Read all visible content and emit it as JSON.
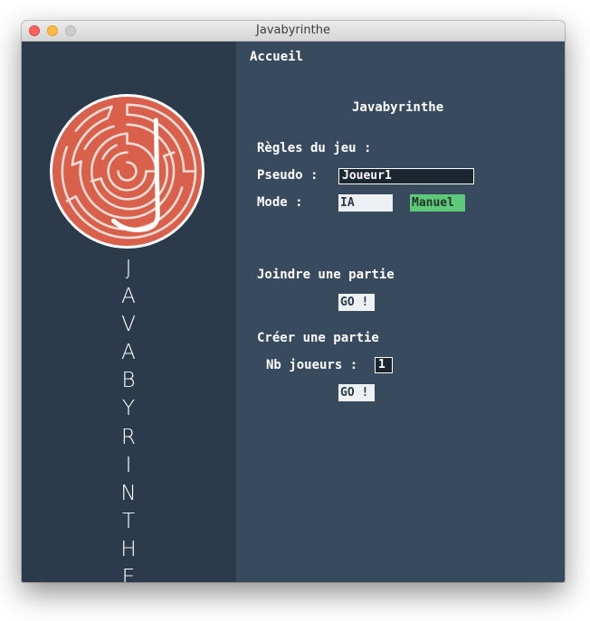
{
  "window": {
    "title": "Javabyrinthe"
  },
  "sidebar": {
    "letters": [
      "J",
      "A",
      "V",
      "A",
      "B",
      "Y",
      "R",
      "I",
      "N",
      "T",
      "H",
      "E"
    ],
    "logo_color": "#d9604a"
  },
  "nav": {
    "home_label": "Accueil"
  },
  "main": {
    "title": "Javabyrinthe",
    "rules_label": "Règles du jeu :",
    "pseudo_label": "Pseudo :",
    "pseudo_value": "Joueur1",
    "mode_label": "Mode :",
    "mode_options": [
      "IA",
      "Manuel"
    ],
    "mode_selected": "Manuel",
    "join": {
      "label": "Joindre une partie",
      "button": "GO !"
    },
    "create": {
      "label": "Créer une partie",
      "players_label": "Nb joueurs :",
      "players_value": "1",
      "button": "GO !"
    }
  },
  "colors": {
    "sidebar_bg": "#2c3b4b",
    "main_bg": "#384a5e",
    "accent_green": "#5fc97a"
  }
}
